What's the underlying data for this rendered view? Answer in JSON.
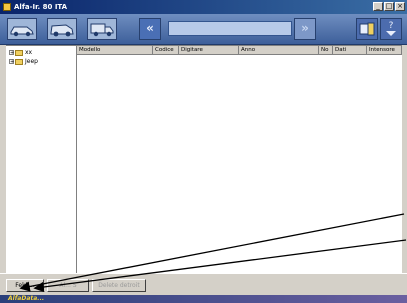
{
  "window": {
    "title": "Alfa-Ir. 80 ITA"
  },
  "titlebar_buttons": {
    "minimize": "_",
    "maximize": "□",
    "close": "×"
  },
  "toolbar": {
    "nav_back": "«",
    "nav_forward": "»",
    "search_value": ""
  },
  "tree": {
    "items": [
      {
        "label": "xx",
        "expander": "+"
      },
      {
        "label": "Jeep",
        "expander": "+"
      }
    ]
  },
  "table": {
    "columns": [
      "Modello",
      "Codice",
      "Digitare",
      "Anno",
      "No",
      "Dati",
      "Intensore"
    ]
  },
  "bottom_buttons": [
    {
      "label": "Fekk...",
      "enabled": true
    },
    {
      "label": "Al... S",
      "enabled": false
    },
    {
      "label": "Delete detroit",
      "enabled": false
    }
  ],
  "status": {
    "brand": "AlfaData..."
  },
  "colors": {
    "toolbar": "#3d5f9a",
    "title": "#0a246a",
    "annotation": "#000000"
  }
}
